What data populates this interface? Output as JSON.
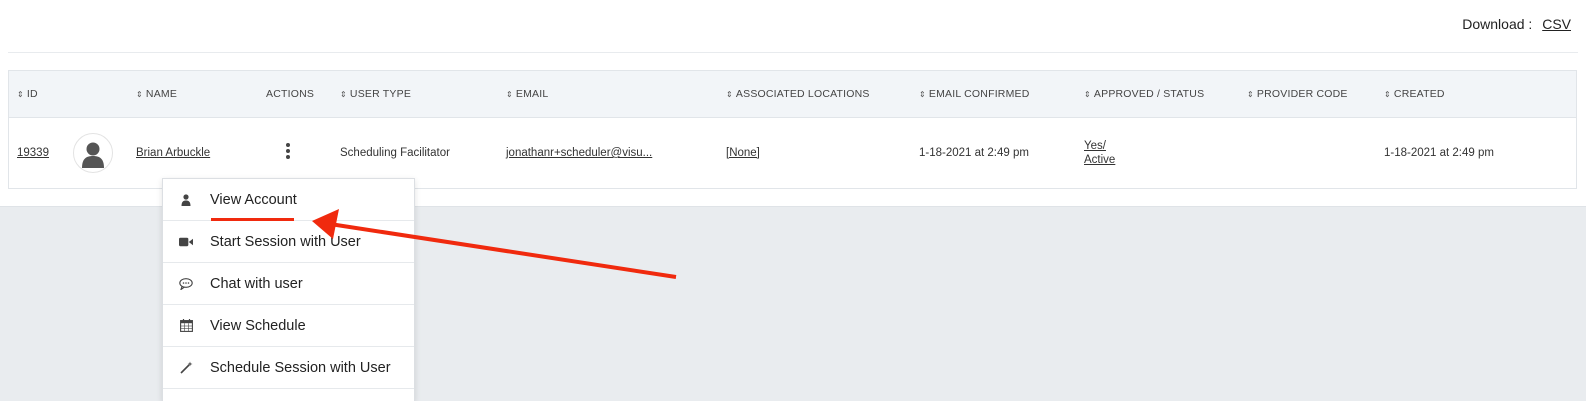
{
  "toolbar": {
    "download_label": "Download :",
    "csv_label": "CSV"
  },
  "table": {
    "headers": {
      "id": "ID",
      "name": "NAME",
      "actions": "ACTIONS",
      "user_type": "USER TYPE",
      "email": "EMAIL",
      "associated_locations": "ASSOCIATED LOCATIONS",
      "email_confirmed": "EMAIL CONFIRMED",
      "approved_status": "APPROVED / STATUS",
      "provider_code": "PROVIDER CODE",
      "created": "CREATED"
    },
    "row": {
      "id": "19339",
      "name": "Brian Arbuckle",
      "user_type": "Scheduling Facilitator",
      "email": "jonathanr+scheduler@visu...",
      "associated_locations": "[None]",
      "email_confirmed": "1-18-2021 at 2:49 pm",
      "approved": "Yes/",
      "status": "Active",
      "provider_code": "",
      "created": "1-18-2021 at 2:49 pm"
    }
  },
  "actions_menu": {
    "items": [
      {
        "label": "View Account",
        "icon": "user-icon"
      },
      {
        "label": "Start Session with User",
        "icon": "video-camera-icon"
      },
      {
        "label": "Chat with user",
        "icon": "chat-bubble-icon"
      },
      {
        "label": "View Schedule",
        "icon": "calendar-icon"
      },
      {
        "label": "Schedule Session with User",
        "icon": "magic-wand-icon"
      }
    ]
  },
  "colors": {
    "annotation": "#f02a0e",
    "page_background": "#e9ecef",
    "header_background": "#f2f5f8"
  }
}
